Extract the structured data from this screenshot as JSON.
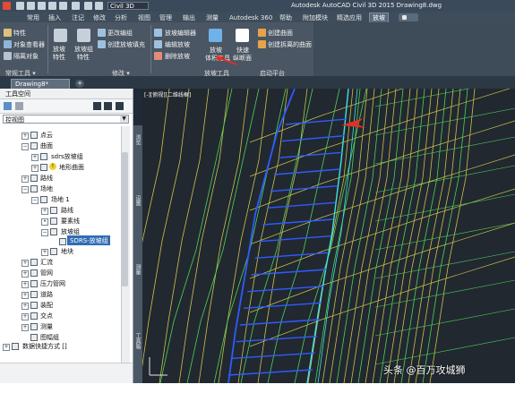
{
  "titlebar": {
    "workspace": "Civil 3D",
    "app_title": "Autodesk AutoCAD Civil 3D 2015    Drawing8.dwg"
  },
  "tabs": [
    "常用",
    "插入",
    "注记",
    "修改",
    "分析",
    "视图",
    "管理",
    "输出",
    "测量",
    "Autodesk 360",
    "帮助",
    "附加模块",
    "精选应用",
    "放坡"
  ],
  "active_tab": "放坡",
  "ribbon": {
    "small_left": [
      "特性",
      "对象查看器",
      "隔离对象"
    ],
    "btn_grading_props": "放坡\n特性",
    "btn_group_props": "放坡组\n特性",
    "small_mid": [
      "更改编组",
      "创建放坡填充"
    ],
    "small_right": [
      "放坡编辑器",
      "编辑放坡",
      "删除放坡"
    ],
    "btn_volume_tools": "放坡\n体积工具",
    "btn_quick_profile": "快速\n纵断面",
    "small_far": [
      "创建曲面",
      "创建拆离的曲面"
    ],
    "panels": {
      "general": "常规工具 ▾",
      "modify": "修改 ▾",
      "grading_tools": "放坡工具",
      "launch": "启动平台"
    }
  },
  "document": {
    "tab_label": "Drawing8*",
    "add_label": "+"
  },
  "toolspace": {
    "title": "工具空间",
    "view_select": "控视图",
    "tree": [
      {
        "label": "点云",
        "level": 3
      },
      {
        "label": "曲面",
        "level": 3
      },
      {
        "label": "sdrs放坡组",
        "level": 4
      },
      {
        "label": "地形曲面",
        "level": 4
      },
      {
        "label": "路线",
        "level": 3
      },
      {
        "label": "场地",
        "level": 3
      },
      {
        "label": "场地 1",
        "level": 4
      },
      {
        "label": "路线",
        "level": 5
      },
      {
        "label": "要素线",
        "level": 5
      },
      {
        "label": "放坡组",
        "level": 5
      },
      {
        "label": "SDRS-放坡组",
        "level": 6
      },
      {
        "label": "地块",
        "level": 5
      },
      {
        "label": "汇流",
        "level": 3
      },
      {
        "label": "管网",
        "level": 3
      },
      {
        "label": "压力管网",
        "level": 3
      },
      {
        "label": "道路",
        "level": 3
      },
      {
        "label": "装配",
        "level": 3
      },
      {
        "label": "交点",
        "level": 3
      },
      {
        "label": "测量",
        "level": 3
      },
      {
        "label": "图幅组",
        "level": 3
      },
      {
        "label": "数据快捷方式 []",
        "level": 2
      }
    ],
    "selected": "SDRS-放坡组",
    "side_tabs": [
      "浏览",
      "设置",
      "测量",
      "工具箱"
    ]
  },
  "viewport": {
    "label": "[-][俯视][二维线框]"
  },
  "watermark": "头条 @百万攻城狮",
  "colors": {
    "ribbon_bg": "#4a5663",
    "drawing_bg": "#212830",
    "feature_blue": "#2f5bff",
    "cyan": "#44e0e0",
    "yellow": "#c9c24a",
    "green": "#4fd15a",
    "arrow": "#e0302a",
    "selection": "#2f6db5"
  }
}
